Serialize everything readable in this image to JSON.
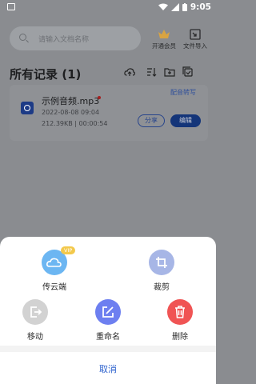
{
  "status_bar": {
    "time": "9:05"
  },
  "search": {
    "placeholder": "请输入文档名称"
  },
  "header": {
    "vip_label": "开通会员",
    "import_label": "文件导入"
  },
  "records": {
    "title": "所有记录 (1)",
    "link_label": "配音转写"
  },
  "file": {
    "name": "示例音频.mp3",
    "date": "2022-08-08 09:04",
    "info": "212.39KB | 00:00:54",
    "share_label": "分享",
    "edit_label": "编辑"
  },
  "sheet": {
    "upload": {
      "label": "传云端",
      "badge": "VIP"
    },
    "crop": {
      "label": "裁剪"
    },
    "move": {
      "label": "移动"
    },
    "rename": {
      "label": "重命名"
    },
    "delete": {
      "label": "删除"
    },
    "cancel_label": "取消"
  },
  "colors": {
    "upload": "#6cb6f2",
    "crop": "#a7b6e6",
    "move": "#d2d2d2",
    "rename": "#6d7ff0",
    "delete": "#f05454",
    "primary": "#2f63ce"
  }
}
